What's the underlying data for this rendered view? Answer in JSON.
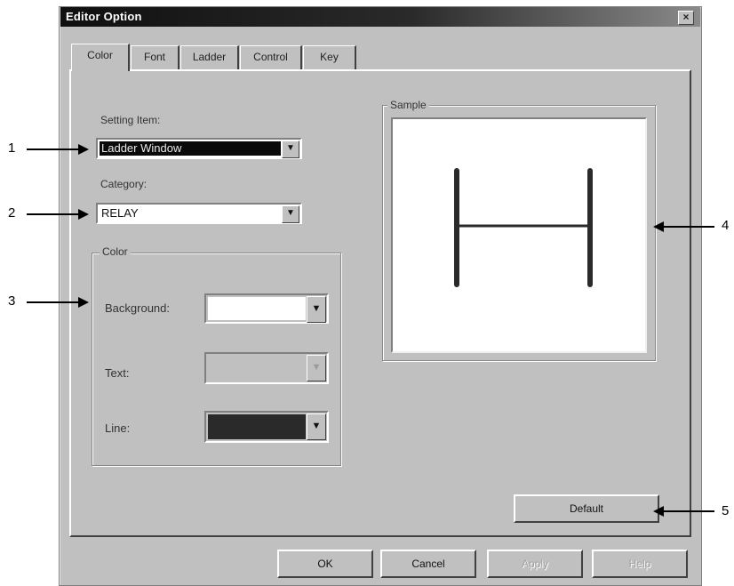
{
  "window": {
    "title": "Editor Option",
    "close_glyph": "×"
  },
  "tabs": [
    {
      "label": "Color",
      "active": true
    },
    {
      "label": "Font",
      "active": false
    },
    {
      "label": "Ladder",
      "active": false
    },
    {
      "label": "Control",
      "active": false
    },
    {
      "label": "Key",
      "active": false
    }
  ],
  "setting_item": {
    "label": "Setting Item:",
    "value": "Ladder Window"
  },
  "category": {
    "label": "Category:",
    "value": "RELAY"
  },
  "color_group": {
    "title": "Color",
    "background": {
      "label": "Background:",
      "color": "#ffffff",
      "enabled": true
    },
    "text": {
      "label": "Text:",
      "color": "#c0c0c0",
      "enabled": false
    },
    "line": {
      "label": "Line:",
      "color": "#2a2a2a",
      "enabled": true
    }
  },
  "sample": {
    "title": "Sample"
  },
  "buttons": {
    "default": "Default",
    "ok": "OK",
    "cancel": "Cancel",
    "apply": "Apply",
    "help": "Help"
  },
  "icons": {
    "dropdown_arrow": "▼"
  },
  "callouts": [
    "1",
    "2",
    "3",
    "4",
    "5"
  ]
}
